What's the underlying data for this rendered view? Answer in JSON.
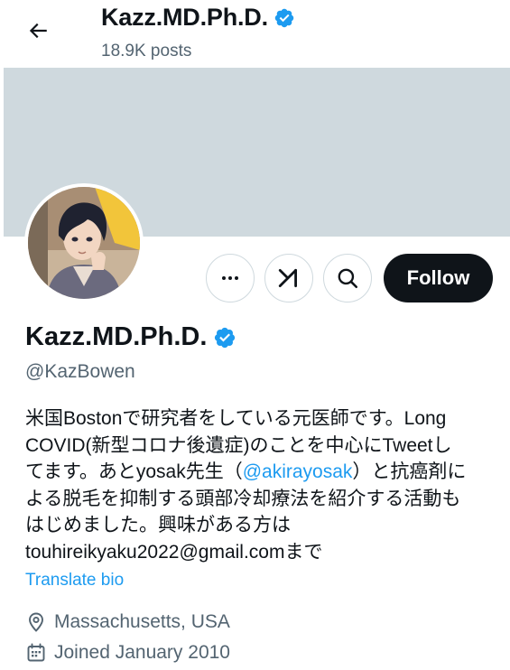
{
  "header": {
    "name": "Kazz.MD.Ph.D.",
    "posts_count": "18.9K posts"
  },
  "profile": {
    "display_name": "Kazz.MD.Ph.D.",
    "handle": "@KazBowen",
    "follow_label": "Follow",
    "bio": {
      "line1": "米国Bostonで研究者をしている元医師です。Long",
      "line2": "COVID(新型コロナ後遺症)のことを中心にTweetし",
      "line3_pre": "てます。あとyosak先生（",
      "line3_mention": "@akirayosak",
      "line3_post": "）と抗癌剤に",
      "line4": "よる脱毛を抑制する頭部冷却療法を紹介する活動も",
      "line5": "はじめました。興味がある方は",
      "line6": "touhireikyaku2022@gmail.comまで"
    },
    "translate_label": "Translate bio",
    "location": "Massachusetts, USA",
    "joined": "Joined January 2010"
  },
  "colors": {
    "accent": "#1d9bf0",
    "banner": "#cfd9de",
    "secondary_text": "#536471",
    "verified_badge": "#1d9bf0"
  },
  "icons": [
    "back-arrow-icon",
    "verified-badge-icon",
    "more-icon",
    "grok-icon",
    "search-icon",
    "location-icon",
    "calendar-icon"
  ]
}
